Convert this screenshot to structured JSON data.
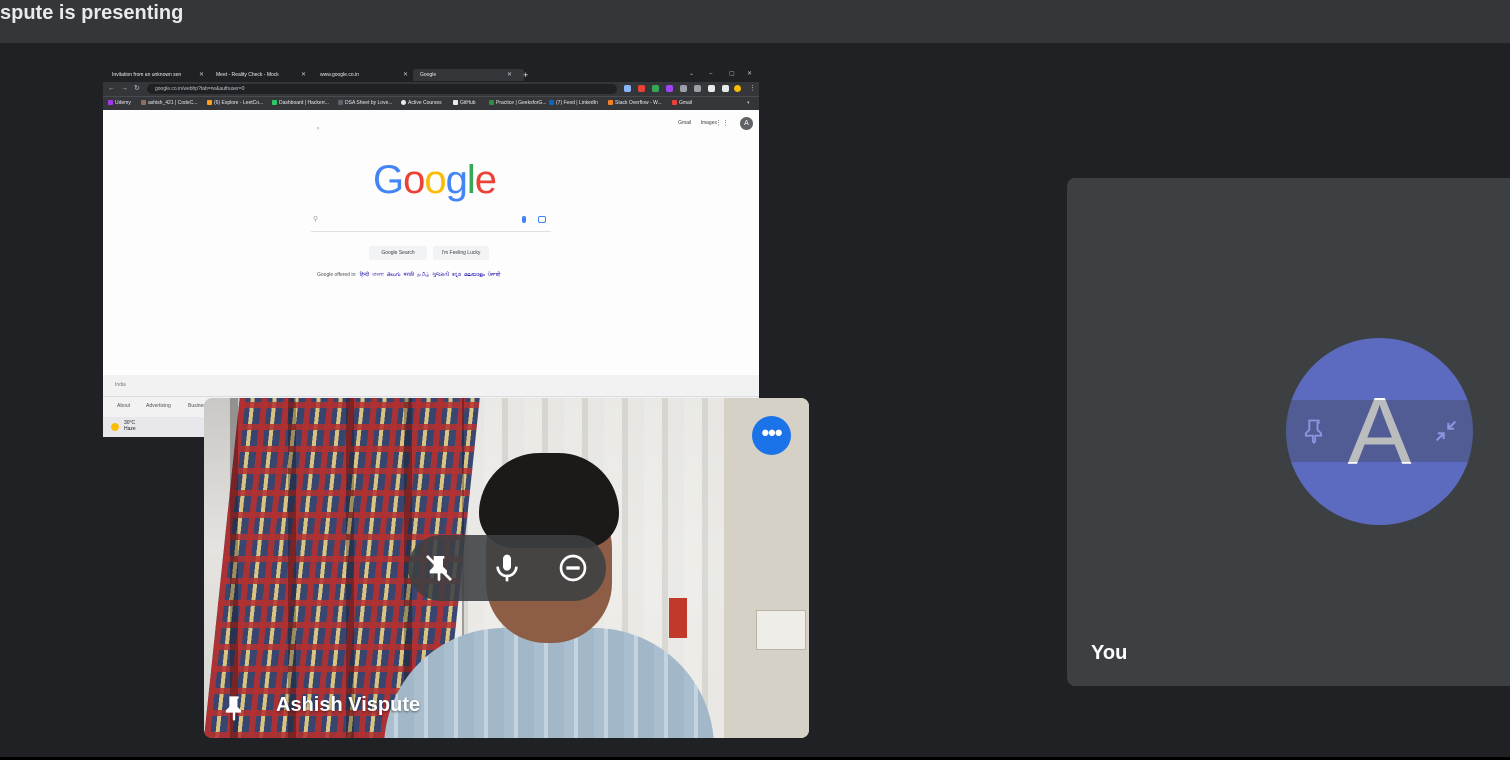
{
  "header": {
    "presenting_text": "spute is presenting"
  },
  "shared_screen": {
    "tabs": [
      {
        "label": "Invitation from an unknown sen"
      },
      {
        "label": "Meet - Reality Check - Mock"
      },
      {
        "label": "www.google.co.in"
      },
      {
        "label": "Google"
      }
    ],
    "new_tab": "+",
    "url": "google.co.in/webhp?tab=rw&authuser=0",
    "bookmarks": [
      "Udemy",
      "ashish_421 | CodeC...",
      "(6) Explore - LeetCo...",
      "Dashboard | Hackerr...",
      "DSA Sheet by Love...",
      "Active Courses",
      "GitHub",
      "Practice | GeeksforG...",
      "(7) Feed | LinkedIn",
      "Stack Overflow - W...",
      "Gmail"
    ],
    "google": {
      "top_links": [
        "Gmail",
        "Images"
      ],
      "avatar": "A",
      "logo_letters": [
        {
          "ch": "G",
          "color": "#4285f4"
        },
        {
          "ch": "o",
          "color": "#ea4335"
        },
        {
          "ch": "o",
          "color": "#fbbc05"
        },
        {
          "ch": "g",
          "color": "#4285f4"
        },
        {
          "ch": "l",
          "color": "#34a853"
        },
        {
          "ch": "e",
          "color": "#ea4335"
        }
      ],
      "search_button": "Google Search",
      "lucky_button": "I'm Feeling Lucky",
      "offered_in": "Google offered in:",
      "languages": [
        "हिन्दी",
        "বাংলা",
        "తెలుగు",
        "मराठी",
        "தமிழ்",
        "ગુજરાતી",
        "ಕನ್ನಡ",
        "മലയാളം",
        "ਪੰਜਾਬੀ"
      ],
      "country": "India",
      "footer_links": [
        "About",
        "Advertising",
        "Business"
      ]
    },
    "weather": {
      "temp": "30°C",
      "condition": "Haze"
    }
  },
  "presenter_tile": {
    "name": "Ashish Vispute",
    "more_label": "•••"
  },
  "self_tile": {
    "label": "You",
    "avatar_letter": "A",
    "avatar_color": "#5c6bc0"
  }
}
